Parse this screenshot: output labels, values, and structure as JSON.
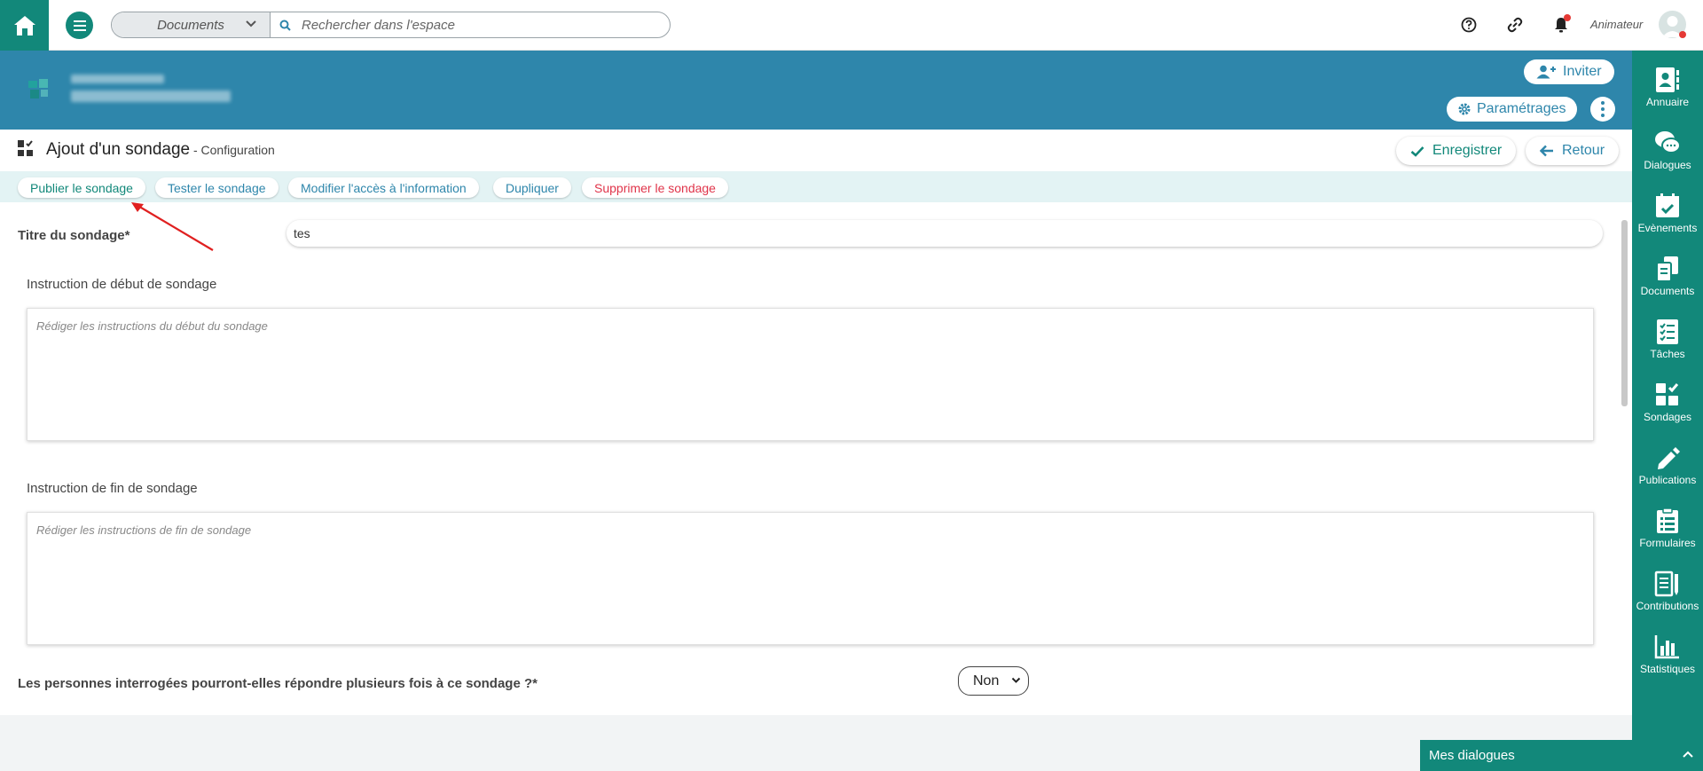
{
  "topbar": {
    "search_scope": "Documents",
    "search_placeholder": "Rechercher dans l'espace",
    "user_role": "Animateur",
    "notification_color": "#e53935"
  },
  "space": {
    "header_color": "#2e86ab",
    "invite_label": "Inviter",
    "settings_label": "Paramétrages"
  },
  "right_nav": {
    "accent": "#12887a",
    "items": [
      {
        "label": "Annuaire",
        "icon": "directory-icon"
      },
      {
        "label": "Dialogues",
        "icon": "chat-icon"
      },
      {
        "label": "Evènements",
        "icon": "calendar-icon"
      },
      {
        "label": "Documents",
        "icon": "documents-icon"
      },
      {
        "label": "Tâches",
        "icon": "tasks-icon"
      },
      {
        "label": "Sondages",
        "icon": "polls-icon"
      },
      {
        "label": "Publications",
        "icon": "pencil-icon"
      },
      {
        "label": "Formulaires",
        "icon": "clipboard-icon"
      },
      {
        "label": "Contributions",
        "icon": "contributions-icon"
      },
      {
        "label": "Statistiques",
        "icon": "chart-icon"
      }
    ]
  },
  "page": {
    "title": "Ajout d'un sondage",
    "subtitle": " - Configuration",
    "save_label": "Enregistrer",
    "back_label": "Retour"
  },
  "toolbar": {
    "publish": "Publier le sondage",
    "test": "Tester le sondage",
    "access": "Modifier l'accès à l'information",
    "duplicate": "Dupliquer",
    "delete": "Supprimer le sondage"
  },
  "form": {
    "title_label": "Titre du sondage*",
    "title_value": "tes",
    "start_label": "Instruction de début de sondage",
    "start_placeholder": "Rédiger les instructions du début du sondage",
    "end_label": "Instruction de fin de sondage",
    "end_placeholder": "Rédiger les instructions de fin de sondage",
    "multiple_label": "Les personnes interrogées pourront-elles répondre plusieurs fois à ce sondage ?*",
    "multiple_value": "Non"
  },
  "footer": {
    "dialogs_label": "Mes dialogues"
  }
}
